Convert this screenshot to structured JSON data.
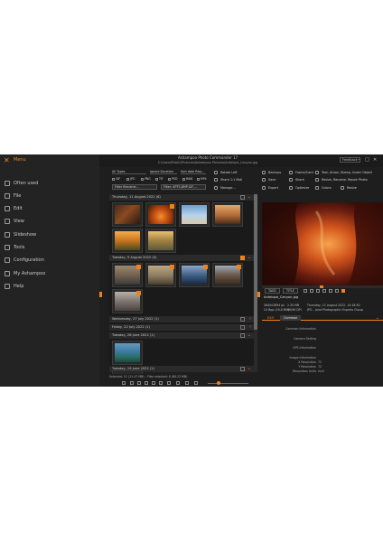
{
  "menu": {
    "title": "Menu",
    "items": [
      "Often used",
      "File",
      "Edit",
      "View",
      "Slideshow",
      "Tools",
      "Configuration",
      "My Ashampoo",
      "Help"
    ]
  },
  "window": {
    "title": "Ashampoo Photo Commander 17",
    "path": "C:\\Users\\Public\\Pictures\\Ashampoo Pictures\\Antelope_Canyon.jpg",
    "feedback": "Feedback",
    "minimize": "–",
    "maximize": "□",
    "close": "✕"
  },
  "filters": {
    "type_select": "All Types",
    "ignore_select": "Ignore Duration",
    "sort_select": "Sort date Rais…",
    "types": [
      "GIF",
      "JPG",
      "PNG",
      "TIF",
      "PSD",
      "RAW",
      "MP4"
    ],
    "search_placeholder": "Filter filename…",
    "extensions": "Filter: APTS,BMP,GIF,…"
  },
  "tools": {
    "col1": [
      "Rotate Left",
      "Share 1:1 Mail",
      "Manage…"
    ],
    "col2": [
      "Backups",
      "Save",
      "Export"
    ],
    "col3": [
      "Frame/Card",
      "Share",
      "Optimize"
    ],
    "col4": [
      "Text, Arrow, Stamp, Insert Object",
      "Resize, Rename, Repair Photo",
      "Colors",
      "Resize"
    ]
  },
  "gallery": {
    "groups": [
      "Thursday, 11 August 2022 (6)",
      "Tuesday, 9 August 2022 (5)",
      "Wednesday, 27 July 2022 (1)",
      "Friday, 22 July 2022 (1)",
      "Tuesday, 28 June 2022 (1)",
      "Tuesday, 19 June 2022 (1)"
    ],
    "status": "Selected: 11 (21.47 MB) – Files selected: 8 (89.23 MB)"
  },
  "preview": {
    "tabs": [
      "TAGS",
      "TITLE"
    ]
  },
  "info": {
    "filename": "Antelope_Canyon.jpg",
    "line1a": "5840x3894 px",
    "line1b": "2.35 MB",
    "line1c": "Thursday, 11 August 2022, 14:18:50",
    "line2a": "24 Bpp (16.8 Mill)",
    "line2b": "96/96 DPI",
    "line2c": "JPG – Joint Photographic Experts Group",
    "tab_exif": "EXIF",
    "tab_common": "Common",
    "rows": [
      {
        "label": "Common Information",
        "value": ""
      },
      {
        "label": "Camera Setting",
        "value": ""
      },
      {
        "label": "GPS Information",
        "value": ""
      },
      {
        "label": "Image Information",
        "value": ""
      },
      {
        "label": "X Resolution",
        "value": "72"
      },
      {
        "label": "Y Resolution",
        "value": "72"
      },
      {
        "label": "Resolution Units",
        "value": "Inch"
      }
    ]
  },
  "colors": {
    "accent": "#f0821e",
    "background": "#1e1e1e",
    "panel": "#232323"
  }
}
